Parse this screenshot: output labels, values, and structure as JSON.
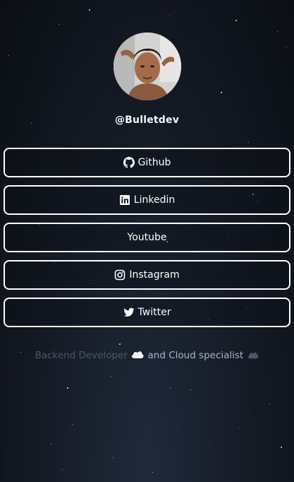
{
  "profile": {
    "handle": "@Bulletdev"
  },
  "links": [
    {
      "label": "Github",
      "icon": "github-icon"
    },
    {
      "label": "Linkedin",
      "icon": "linkedin-icon"
    },
    {
      "label": "Youtube",
      "icon": ""
    },
    {
      "label": "Instagram",
      "icon": "instagram-icon"
    },
    {
      "label": "Twitter",
      "icon": "twitter-icon"
    }
  ],
  "tagline": {
    "part1": "Backend Developer",
    "part2": "and Cloud specialist"
  },
  "colors": {
    "background": "#141a24",
    "button_border": "#ffffff",
    "text": "#ffffff"
  }
}
